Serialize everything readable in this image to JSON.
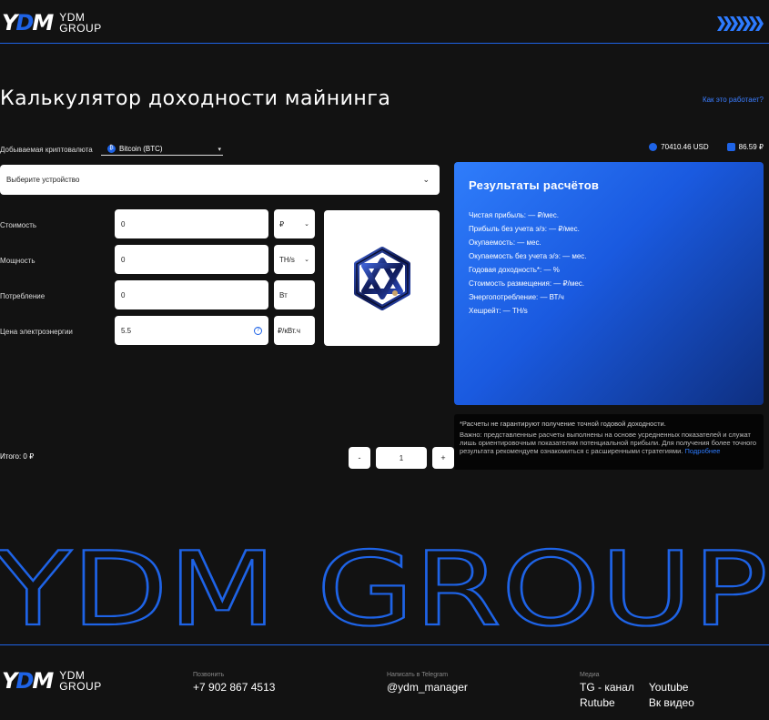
{
  "header": {
    "brand_mark": "YDM",
    "brand_line1": "YDM",
    "brand_line2": "GROUP"
  },
  "title": "Калькулятор доходности майнинга",
  "how_link": "Как это работает?",
  "crypto": {
    "label": "Добываемая криптовалюта",
    "selected": "Bitcoin (BTC)"
  },
  "rates": [
    {
      "value": "70410.46 USD"
    },
    {
      "value": "86.59 ₽"
    }
  ],
  "device": {
    "placeholder": "Выберите устройство"
  },
  "form": {
    "cost": {
      "label": "Стоимость",
      "value": "0",
      "unit": "₽"
    },
    "power": {
      "label": "Мощность",
      "value": "0",
      "unit": "TH/s"
    },
    "consumption": {
      "label": "Потребление",
      "value": "0",
      "unit": "Вт"
    },
    "price": {
      "label": "Цена электроэнергии",
      "value": "5.5",
      "unit": "₽/кВт.ч"
    }
  },
  "results": {
    "title": "Результаты расчётов",
    "lines": [
      "Чистая прибыль: — ₽/мес.",
      "Прибыль без учета э/э: — ₽/мес.",
      "Окупаемость: — мес.",
      "Окупаемость без учета э/э: — мес.",
      "Годовая доходность*: — %",
      "Стоимость размещения: — ₽/мес.",
      "Энергопотребление: — ВТ/ч",
      "Хешрейт: — TH/s"
    ]
  },
  "note": {
    "line1": "*Расчеты не гарантируют получение точной годовой доходности.",
    "line2": "Важно: представленные расчеты выполнены на основе усредненных показателей и служат лишь ориентировочным показателям потенциальной прибыли. Для получения более точного результата рекомендуем ознакомиться с расширенными стратегиями.",
    "more": "Подробнее"
  },
  "total": "Итого: 0 ₽",
  "stepper": {
    "minus": "-",
    "value": "1",
    "plus": "+"
  },
  "big_text": "YDM GROUP",
  "footer": {
    "call_caption": "Позвонить",
    "phone": "+7 902 867 4513",
    "tg_caption": "Написать в Telegram",
    "tg": "@ydm_manager",
    "media_caption": "Медиа",
    "media": [
      "TG - канал",
      "Youtube",
      "Rutube",
      "Вк видео"
    ]
  },
  "colors": {
    "accent": "#1e63e6",
    "background": "#121212"
  }
}
